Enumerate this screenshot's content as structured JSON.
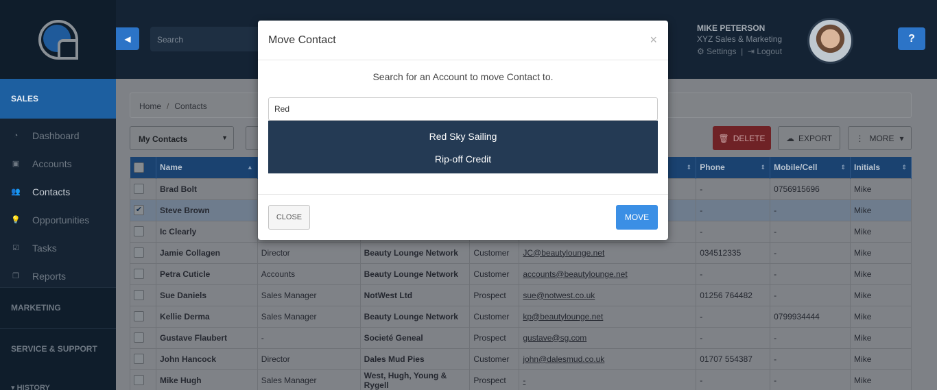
{
  "sidebar": {
    "section_sales": "SALES",
    "items": [
      {
        "label": "Dashboard",
        "icon": "dashboard-icon",
        "glyph": "◔"
      },
      {
        "label": "Accounts",
        "icon": "briefcase-icon",
        "glyph": "▣"
      },
      {
        "label": "Contacts",
        "icon": "users-icon",
        "glyph": "👥"
      },
      {
        "label": "Opportunities",
        "icon": "lightbulb-icon",
        "glyph": "💡"
      },
      {
        "label": "Tasks",
        "icon": "checkbox-icon",
        "glyph": "☑"
      },
      {
        "label": "Reports",
        "icon": "copy-icon",
        "glyph": "❐"
      }
    ],
    "section_marketing": "MARKETING",
    "section_service": "SERVICE & SUPPORT",
    "section_history": "HISTORY"
  },
  "topbar": {
    "search_placeholder": "Search",
    "user_name": "MIKE PETERSON",
    "user_org": "XYZ Sales & Marketing",
    "settings_label": "Settings",
    "logout_label": "Logout",
    "help_label": "?"
  },
  "breadcrumb": {
    "home": "Home",
    "current": "Contacts"
  },
  "toolbar": {
    "filter_value": "My Contacts",
    "delete_label": "DELETE",
    "export_label": "EXPORT",
    "more_label": "MORE"
  },
  "table": {
    "headers": {
      "name": "Name",
      "phone": "Phone",
      "mobile": "Mobile/Cell",
      "initials": "Initials"
    },
    "rows": [
      {
        "name": "Brad Bolt",
        "title": "",
        "account": "",
        "type": "",
        "email": "",
        "phone": "-",
        "mobile": "0756915696",
        "initials": "Mike",
        "checked": false
      },
      {
        "name": "Steve Brown",
        "title": "",
        "account": "",
        "type": "",
        "email": "",
        "phone": "-",
        "mobile": "-",
        "initials": "Mike",
        "checked": true
      },
      {
        "name": "Ic Clearly",
        "title": "",
        "account": "",
        "type": "",
        "email": "",
        "phone": "-",
        "mobile": "-",
        "initials": "Mike",
        "checked": false
      },
      {
        "name": "Jamie Collagen",
        "title": "Director",
        "account": "Beauty Lounge Network",
        "type": "Customer",
        "email": "JC@beautylounge.net",
        "phone": "034512335",
        "mobile": "-",
        "initials": "Mike",
        "checked": false
      },
      {
        "name": "Petra Cuticle",
        "title": "Accounts",
        "account": "Beauty Lounge Network",
        "type": "Customer",
        "email": "accounts@beautylounge.net",
        "phone": "-",
        "mobile": "-",
        "initials": "Mike",
        "checked": false
      },
      {
        "name": "Sue Daniels",
        "title": "Sales Manager",
        "account": "NotWest Ltd",
        "type": "Prospect",
        "email": "sue@notwest.co.uk",
        "phone": "01256 764482",
        "mobile": "-",
        "initials": "Mike",
        "checked": false
      },
      {
        "name": "Kellie Derma",
        "title": "Sales Manager",
        "account": "Beauty Lounge Network",
        "type": "Customer",
        "email": "kp@beautylounge.net",
        "phone": "-",
        "mobile": "0799934444",
        "initials": "Mike",
        "checked": false
      },
      {
        "name": "Gustave Flaubert",
        "title": "-",
        "account": "Societé Geneal",
        "type": "Prospect",
        "email": "gustave@sg.com",
        "phone": "-",
        "mobile": "-",
        "initials": "Mike",
        "checked": false
      },
      {
        "name": "John Hancock",
        "title": "Director",
        "account": "Dales Mud Pies",
        "type": "Customer",
        "email": "john@dalesmud.co.uk",
        "phone": "01707 554387",
        "mobile": "-",
        "initials": "Mike",
        "checked": false
      },
      {
        "name": "Mike Hugh",
        "title": "Sales Manager",
        "account": "West, Hugh, Young & Rygell",
        "type": "Prospect",
        "email": "-",
        "phone": "-",
        "mobile": "-",
        "initials": "Mike",
        "checked": false
      }
    ]
  },
  "modal": {
    "title": "Move Contact",
    "close_x": "×",
    "instruction": "Search for an Account to move Contact to.",
    "input_value": "Red",
    "results": [
      "Red Sky Sailing",
      "Rip-off Credit"
    ],
    "close_label": "CLOSE",
    "move_label": "MOVE"
  }
}
